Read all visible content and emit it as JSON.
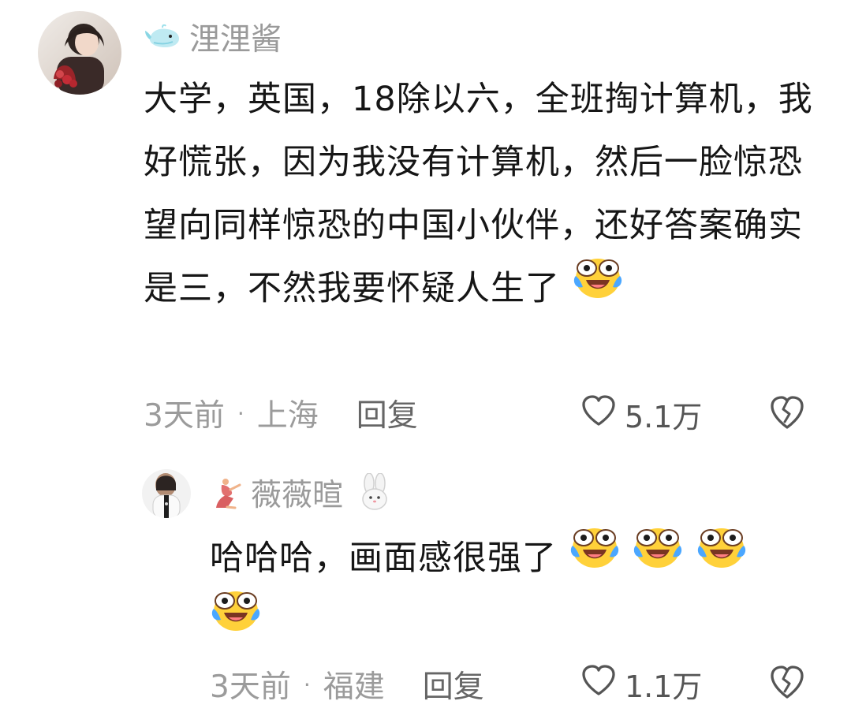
{
  "comments": [
    {
      "username": "浬浬酱",
      "text": "大学，英国，18除以六，全班掏计算机，我好慌张，因为我没有计算机，然后一脸惊恐望向同样惊恐的中国小伙伴，还好答案确实是三，不然我要怀疑人生了",
      "emoji_count": 1,
      "time": "3天前",
      "location": "上海",
      "dot": "·",
      "reply_label": "回复",
      "likes": "5.1万"
    },
    {
      "username": "薇薇暄",
      "text": "哈哈哈，画面感很强了",
      "emoji_count": 4,
      "time": "3天前",
      "location": "福建",
      "dot": "·",
      "reply_label": "回复",
      "likes": "1.1万"
    }
  ],
  "icons": {
    "whale": "whale-icon",
    "dancer": "dancer-icon",
    "bunny": "bunny-icon",
    "heart": "heart-outline-icon",
    "dislike": "broken-heart-icon",
    "laugh_cry": "laugh-cry-emoji-icon"
  },
  "colors": {
    "text_primary": "#161616",
    "text_secondary": "#9b9b9b",
    "reply": "#666666",
    "emoji_yellow": "#ffd13a",
    "emoji_tear": "#4ba7ff"
  }
}
